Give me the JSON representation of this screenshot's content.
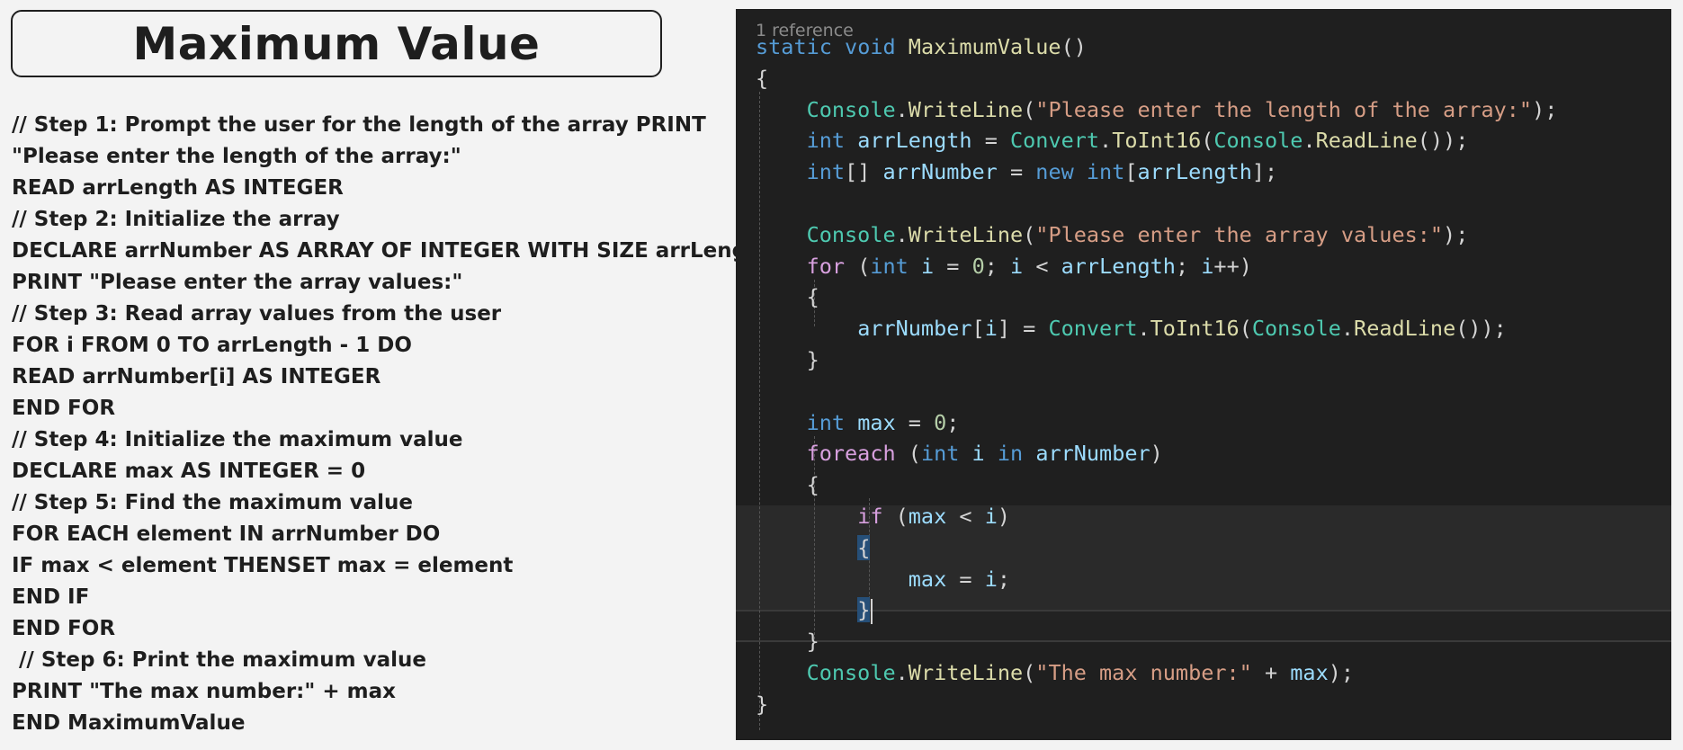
{
  "title": "Maximum Value",
  "pseudocode": [
    "// Step 1: Prompt the user for the length of the array PRINT",
    "\"Please enter the length of the array:\"",
    "READ arrLength AS INTEGER",
    "// Step 2: Initialize the array",
    "DECLARE arrNumber AS ARRAY OF INTEGER WITH SIZE arrLength",
    "PRINT \"Please enter the array values:\"",
    "// Step 3: Read array values from the user",
    "FOR i FROM 0 TO arrLength - 1 DO",
    "READ arrNumber[i] AS INTEGER",
    "END FOR",
    "// Step 4: Initialize the maximum value",
    "DECLARE max AS INTEGER = 0",
    "// Step 5: Find the maximum value",
    "FOR EACH element IN arrNumber DO",
    "IF max < element THENSET max = element",
    "END IF",
    "END FOR",
    " // Step 6: Print the maximum value",
    "PRINT \"The max number:\" + max",
    "END MaximumValue"
  ],
  "editor": {
    "codelens": "1 reference",
    "lines": [
      {
        "indent": 0,
        "tokens": [
          [
            "kw",
            "static"
          ],
          [
            "pn",
            " "
          ],
          [
            "kw",
            "void"
          ],
          [
            "pn",
            " "
          ],
          [
            "fn",
            "MaximumValue"
          ],
          [
            "pn",
            "()"
          ]
        ]
      },
      {
        "indent": 0,
        "tokens": [
          [
            "pn",
            "{"
          ]
        ]
      },
      {
        "indent": 1,
        "tokens": [
          [
            "type",
            "Console"
          ],
          [
            "pn",
            "."
          ],
          [
            "fn",
            "WriteLine"
          ],
          [
            "pn",
            "("
          ],
          [
            "str",
            "\"Please enter the length of the array:\""
          ],
          [
            "pn",
            ");"
          ]
        ]
      },
      {
        "indent": 1,
        "tokens": [
          [
            "kw",
            "int"
          ],
          [
            "pn",
            " "
          ],
          [
            "var",
            "arrLength"
          ],
          [
            "pn",
            " = "
          ],
          [
            "type",
            "Convert"
          ],
          [
            "pn",
            "."
          ],
          [
            "fn",
            "ToInt16"
          ],
          [
            "pn",
            "("
          ],
          [
            "type",
            "Console"
          ],
          [
            "pn",
            "."
          ],
          [
            "fn",
            "ReadLine"
          ],
          [
            "pn",
            "());"
          ]
        ]
      },
      {
        "indent": 1,
        "tokens": [
          [
            "kw",
            "int"
          ],
          [
            "pn",
            "[] "
          ],
          [
            "var",
            "arrNumber"
          ],
          [
            "pn",
            " = "
          ],
          [
            "kw",
            "new"
          ],
          [
            "pn",
            " "
          ],
          [
            "kw",
            "int"
          ],
          [
            "pn",
            "["
          ],
          [
            "var",
            "arrLength"
          ],
          [
            "pn",
            "];"
          ]
        ]
      },
      {
        "indent": 0,
        "tokens": []
      },
      {
        "indent": 1,
        "tokens": [
          [
            "type",
            "Console"
          ],
          [
            "pn",
            "."
          ],
          [
            "fn",
            "WriteLine"
          ],
          [
            "pn",
            "("
          ],
          [
            "str",
            "\"Please enter the array values:\""
          ],
          [
            "pn",
            ");"
          ]
        ]
      },
      {
        "indent": 1,
        "tokens": [
          [
            "ctl",
            "for"
          ],
          [
            "pn",
            " ("
          ],
          [
            "kw",
            "int"
          ],
          [
            "pn",
            " "
          ],
          [
            "var",
            "i"
          ],
          [
            "pn",
            " = "
          ],
          [
            "num",
            "0"
          ],
          [
            "pn",
            "; "
          ],
          [
            "var",
            "i"
          ],
          [
            "pn",
            " < "
          ],
          [
            "var",
            "arrLength"
          ],
          [
            "pn",
            "; "
          ],
          [
            "var",
            "i"
          ],
          [
            "pn",
            "++)"
          ]
        ]
      },
      {
        "indent": 1,
        "tokens": [
          [
            "pn",
            "{"
          ]
        ]
      },
      {
        "indent": 2,
        "tokens": [
          [
            "var",
            "arrNumber"
          ],
          [
            "pn",
            "["
          ],
          [
            "var",
            "i"
          ],
          [
            "pn",
            "] = "
          ],
          [
            "type",
            "Convert"
          ],
          [
            "pn",
            "."
          ],
          [
            "fn",
            "ToInt16"
          ],
          [
            "pn",
            "("
          ],
          [
            "type",
            "Console"
          ],
          [
            "pn",
            "."
          ],
          [
            "fn",
            "ReadLine"
          ],
          [
            "pn",
            "());"
          ]
        ]
      },
      {
        "indent": 1,
        "tokens": [
          [
            "pn",
            "}"
          ]
        ]
      },
      {
        "indent": 0,
        "tokens": []
      },
      {
        "indent": 1,
        "tokens": [
          [
            "kw",
            "int"
          ],
          [
            "pn",
            " "
          ],
          [
            "var",
            "max"
          ],
          [
            "pn",
            " = "
          ],
          [
            "num",
            "0"
          ],
          [
            "pn",
            ";"
          ]
        ]
      },
      {
        "indent": 1,
        "tokens": [
          [
            "ctl",
            "foreach"
          ],
          [
            "pn",
            " ("
          ],
          [
            "kw",
            "int"
          ],
          [
            "pn",
            " "
          ],
          [
            "var",
            "i"
          ],
          [
            "pn",
            " "
          ],
          [
            "kw",
            "in"
          ],
          [
            "pn",
            " "
          ],
          [
            "var",
            "arrNumber"
          ],
          [
            "pn",
            ")"
          ]
        ]
      },
      {
        "indent": 1,
        "tokens": [
          [
            "pn",
            "{"
          ]
        ]
      },
      {
        "indent": 2,
        "tokens": [
          [
            "ctl",
            "if"
          ],
          [
            "pn",
            " ("
          ],
          [
            "var",
            "max"
          ],
          [
            "pn",
            " < "
          ],
          [
            "var",
            "i"
          ],
          [
            "pn",
            ")"
          ]
        ]
      },
      {
        "indent": 2,
        "tokens": [
          [
            "bh",
            "{"
          ]
        ]
      },
      {
        "indent": 3,
        "tokens": [
          [
            "var",
            "max"
          ],
          [
            "pn",
            " = "
          ],
          [
            "var",
            "i"
          ],
          [
            "pn",
            ";"
          ]
        ]
      },
      {
        "indent": 2,
        "tokens": [
          [
            "bh",
            "}"
          ],
          [
            "cur",
            ""
          ]
        ]
      },
      {
        "indent": 1,
        "tokens": [
          [
            "pn",
            "}"
          ]
        ]
      },
      {
        "indent": 1,
        "tokens": [
          [
            "type",
            "Console"
          ],
          [
            "pn",
            "."
          ],
          [
            "fn",
            "WriteLine"
          ],
          [
            "pn",
            "("
          ],
          [
            "str",
            "\"The max number:\""
          ],
          [
            "pn",
            " + "
          ],
          [
            "var",
            "max"
          ],
          [
            "pn",
            ");"
          ]
        ]
      },
      {
        "indent": 0,
        "tokens": [
          [
            "pn",
            "}"
          ]
        ]
      }
    ]
  },
  "colors": {
    "keyword": "#569cd6",
    "control": "#d8a0df",
    "type": "#4ec9b0",
    "function": "#dcdcaa",
    "variable": "#9cdcfe",
    "string": "#d69d85",
    "number": "#b5cea8",
    "editor_bg": "#1f1f1f"
  }
}
